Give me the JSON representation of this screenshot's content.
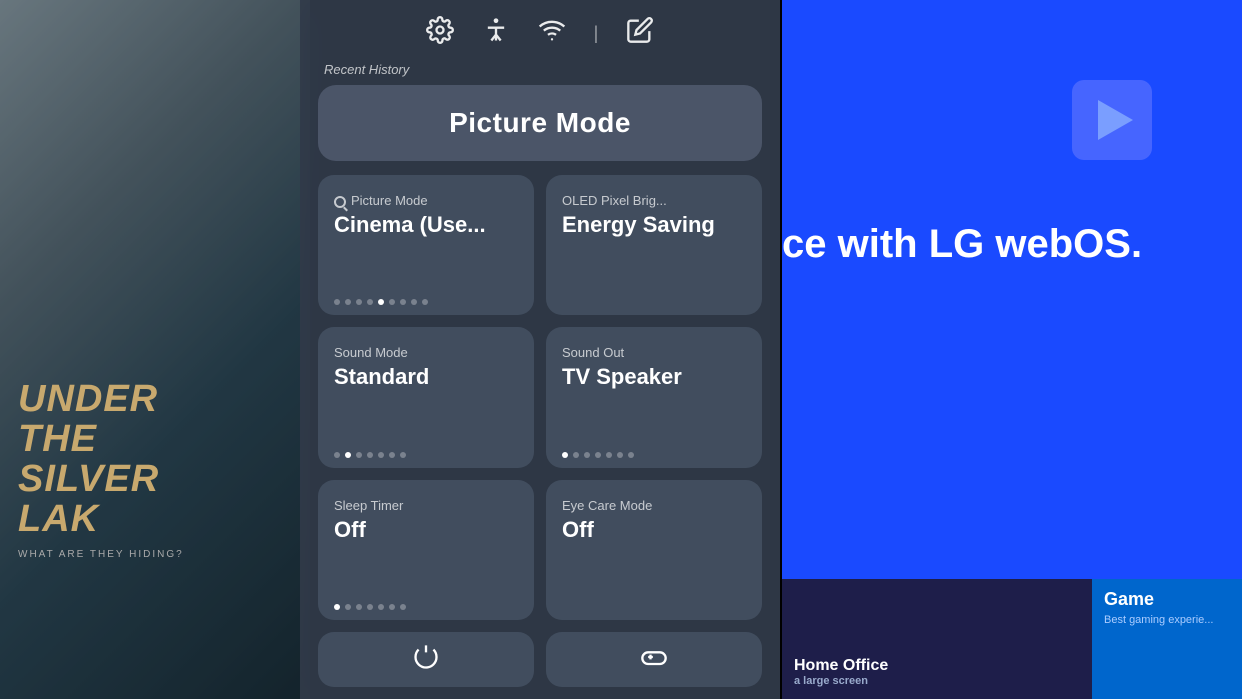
{
  "background": {
    "left_gradient_start": "#8B9EA8",
    "left_gradient_end": "#1a2f3a",
    "right_bg": "#1a4aff"
  },
  "under_silver_lake": {
    "line1": "UNDER",
    "line2": "THE",
    "line3": "SILVER",
    "line4": "LAK",
    "subtitle": "WHAT ARE THEY HIDING?"
  },
  "right_panel": {
    "headline": "ce with LG webOS.",
    "home_office_label": "Home Office",
    "home_office_sub": "a large screen",
    "game_label": "Game",
    "game_sub": "Best gaming experie..."
  },
  "quick_settings": {
    "recent_history_label": "Recent History",
    "hero_button_label": "Picture Mode",
    "icons": {
      "settings_icon": "⚙",
      "accessibility_icon": "♿",
      "wifi_icon": "wifi",
      "divider": "|",
      "edit_icon": "✏"
    },
    "cards": [
      {
        "id": "picture-mode-card",
        "label": "Picture Mode",
        "value": "Cinema (Use...",
        "dots": [
          false,
          false,
          false,
          false,
          true,
          false,
          false,
          false,
          false
        ],
        "has_search": true
      },
      {
        "id": "oled-brightness-card",
        "label": "OLED Pixel Brig...",
        "value": "Energy Saving",
        "dots": []
      },
      {
        "id": "sound-mode-card",
        "label": "Sound Mode",
        "value": "Standard",
        "dots": [
          false,
          true,
          false,
          false,
          false,
          false,
          false
        ]
      },
      {
        "id": "sound-out-card",
        "label": "Sound Out",
        "value": "TV Speaker",
        "dots": [
          true,
          false,
          false,
          false,
          false,
          false,
          false
        ]
      },
      {
        "id": "sleep-timer-card",
        "label": "Sleep Timer",
        "value": "Off",
        "dots": [
          true,
          false,
          false,
          false,
          false,
          false,
          false
        ]
      },
      {
        "id": "eye-care-card",
        "label": "Eye Care Mode",
        "value": "Off",
        "dots": []
      }
    ],
    "bottom_cards": [
      {
        "id": "power-card",
        "icon": "⏻"
      },
      {
        "id": "gamepad-card",
        "icon": "🎮"
      }
    ]
  }
}
